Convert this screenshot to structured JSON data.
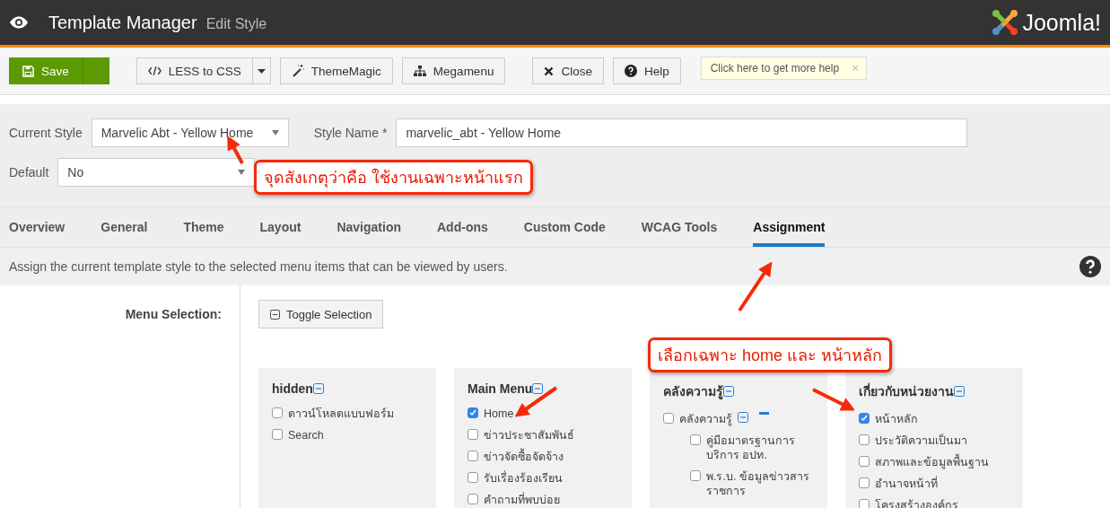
{
  "header": {
    "title": "Template Manager",
    "subtitle": "Edit Style",
    "logo_text": "Joomla!"
  },
  "toolbar": {
    "buttons": [
      {
        "label": "Save",
        "kind": "primary",
        "split": true
      },
      {
        "label": "LESS to CSS",
        "kind": "code",
        "split": true
      },
      {
        "label": "ThemeMagic",
        "kind": "magic",
        "split": false
      },
      {
        "label": "Megamenu",
        "kind": "sitemap",
        "split": false
      },
      {
        "label": "Close",
        "kind": "close",
        "split": false
      },
      {
        "label": "Help",
        "kind": "help",
        "split": false
      }
    ],
    "tooltip": "Click here to get more help",
    "tooltip_close": "×"
  },
  "form": {
    "current_style": {
      "label": "Current Style",
      "value": "Marvelic Abt - Yellow Home"
    },
    "style_name": {
      "label": "Style Name *",
      "value": "marvelic_abt - Yellow Home"
    },
    "default": {
      "label": "Default",
      "value": "No"
    }
  },
  "tabs": [
    {
      "label": "Overview",
      "selected": false
    },
    {
      "label": "General",
      "selected": false
    },
    {
      "label": "Theme",
      "selected": false
    },
    {
      "label": "Layout",
      "selected": false
    },
    {
      "label": "Navigation",
      "selected": false
    },
    {
      "label": "Add-ons",
      "selected": false
    },
    {
      "label": "Custom Code",
      "selected": false
    },
    {
      "label": "WCAG Tools",
      "selected": false
    },
    {
      "label": "Assignment",
      "selected": true
    }
  ],
  "description": "Assign the current template style to the selected menu items that can be viewed by users.",
  "menu_selection": {
    "label": "Menu Selection:",
    "toggle_button": "Toggle Selection",
    "menus": [
      {
        "title": "hidden",
        "items": [
          {
            "label": "ดาวน์โหลดแบบฟอร์ม",
            "checked": false
          },
          {
            "label": "Search",
            "checked": false
          }
        ]
      },
      {
        "title": "Main Menu",
        "items": [
          {
            "label": "Home",
            "checked": true
          },
          {
            "label": "ข่าวประชาสัมพันธ์",
            "checked": false
          },
          {
            "label": "ข่าวจัดซื้อจัดจ้าง",
            "checked": false
          },
          {
            "label": "รับเรื่องร้องเรียน",
            "checked": false
          },
          {
            "label": "คำถามที่พบบ่อย",
            "checked": false
          }
        ]
      },
      {
        "title": "คลังความรู้",
        "items": [
          {
            "label": "คลังความรู้",
            "checked": false,
            "children": [
              {
                "label": "คู่มือมาตรฐานการบริการ อปท.",
                "checked": false
              },
              {
                "label": "พ.ร.บ. ข้อมูลข่าวสารราชการ",
                "checked": false
              }
            ]
          }
        ]
      },
      {
        "title": "เกี่ยวกับหน่วยงาน",
        "items": [
          {
            "label": "หน้าหลัก",
            "checked": true
          },
          {
            "label": "ประวัติความเป็นมา",
            "checked": false
          },
          {
            "label": "สภาพและข้อมูลพื้นฐาน",
            "checked": false
          },
          {
            "label": "อำนาจหน้าที่",
            "checked": false
          },
          {
            "label": "โครงสร้างองค์กร",
            "checked": false
          }
        ]
      }
    ]
  },
  "annotations": [
    "จุดสังเกตุว่าคือ ใช้งานเฉพาะหน้าแรก",
    "เลือกเฉพาะ home และ หน้าหลัก"
  ]
}
